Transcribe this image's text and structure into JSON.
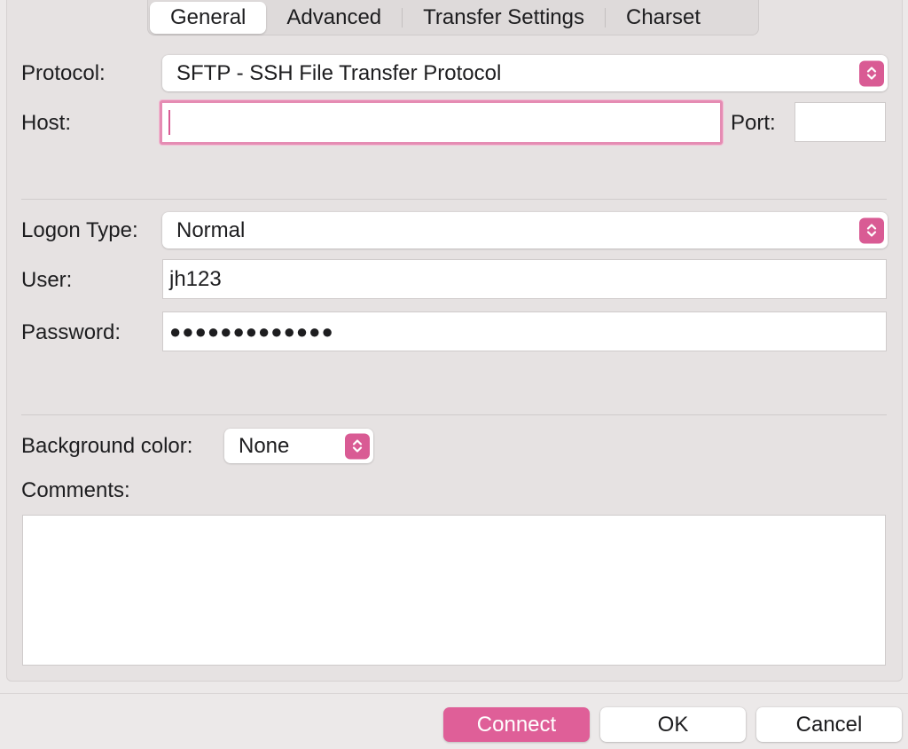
{
  "tabs": [
    {
      "label": "General"
    },
    {
      "label": "Advanced"
    },
    {
      "label": "Transfer Settings"
    },
    {
      "label": "Charset"
    }
  ],
  "active_tab": "General",
  "form": {
    "protocol_label": "Protocol:",
    "protocol_value": "SFTP - SSH File Transfer Protocol",
    "host_label": "Host:",
    "host_value": "",
    "port_label": "Port:",
    "port_value": "",
    "logon_type_label": "Logon Type:",
    "logon_type_value": "Normal",
    "user_label": "User:",
    "user_value": "jh123",
    "password_label": "Password:",
    "password_value": "●●●●●●●●●●●●●",
    "background_color_label": "Background color:",
    "background_color_value": "None",
    "comments_label": "Comments:",
    "comments_value": ""
  },
  "buttons": {
    "connect": "Connect",
    "ok": "OK",
    "cancel": "Cancel"
  },
  "icons": {
    "select_chevron": "chevron-up-down-icon"
  },
  "colors": {
    "accent": "#df5f98",
    "focus_ring": "#e58cb3",
    "window_bg": "#ece9e9"
  }
}
